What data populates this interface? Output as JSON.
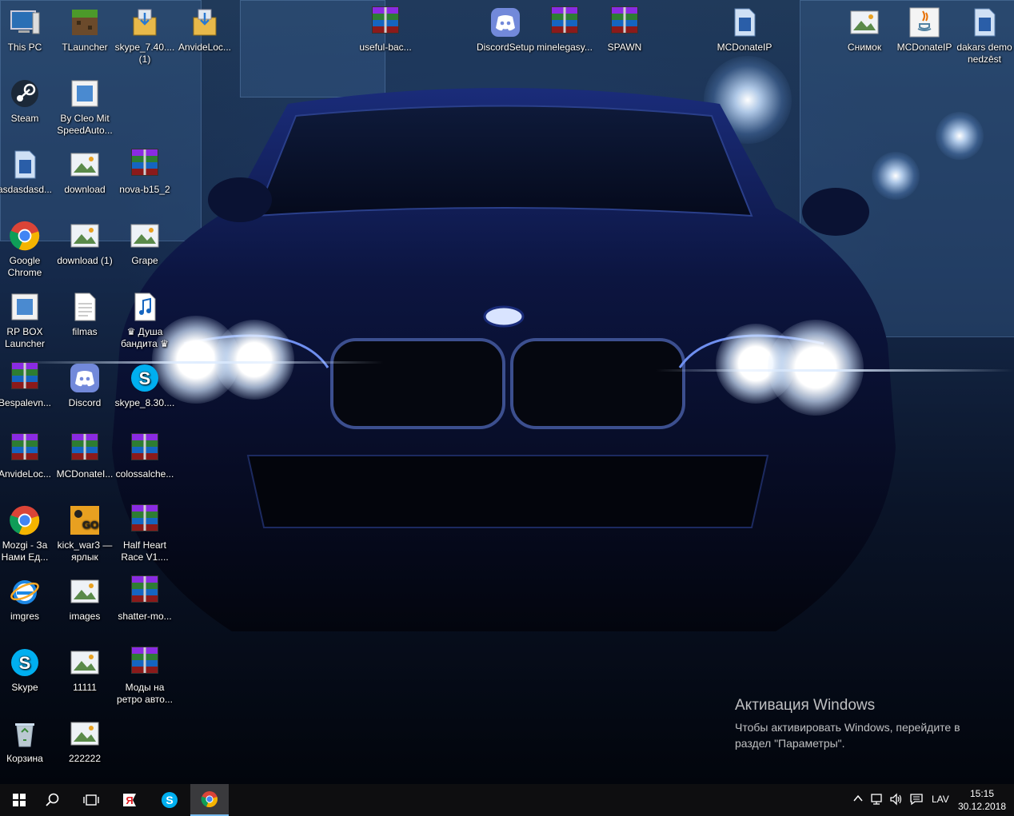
{
  "desktop": {
    "icons": [
      {
        "label": "This PC",
        "kind": "pc-icon"
      },
      {
        "label": "TLauncher",
        "kind": "tlauncher-icon"
      },
      {
        "label": "skype_7.40....\n(1)",
        "kind": "installer-icon"
      },
      {
        "label": "AnvideLoc...",
        "kind": "installer-icon"
      },
      {
        "label": "useful-bac...",
        "kind": "winrar-archive-icon"
      },
      {
        "label": "DiscordSetup",
        "kind": "discord-icon"
      },
      {
        "label": "minelegasy...",
        "kind": "winrar-archive-icon"
      },
      {
        "label": "SPAWN",
        "kind": "winrar-archive-icon"
      },
      {
        "label": "MCDonateIP",
        "kind": "file-icon"
      },
      {
        "label": "Снимок",
        "kind": "image-icon"
      },
      {
        "label": "MCDonateIP",
        "kind": "java-icon"
      },
      {
        "label": "dakars demo\nnedzēst",
        "kind": "file-icon"
      },
      {
        "label": "Steam",
        "kind": "steam-icon"
      },
      {
        "label": "By Cleo Mit\nSpeedAuto...",
        "kind": "shortcut-icon"
      },
      {
        "label": "asdasdasd...",
        "kind": "file-icon"
      },
      {
        "label": "download",
        "kind": "image-icon"
      },
      {
        "label": "nova-b15_2",
        "kind": "winrar-archive-icon"
      },
      {
        "label": "Google\nChrome",
        "kind": "chrome-icon"
      },
      {
        "label": "download (1)",
        "kind": "image-icon"
      },
      {
        "label": "Grape",
        "kind": "image-icon"
      },
      {
        "label": "RP BOX\nLauncher",
        "kind": "shortcut-icon"
      },
      {
        "label": "filmas",
        "kind": "text-file-icon"
      },
      {
        "label": "♛ Душа\nбандита ♛",
        "kind": "mp3-icon"
      },
      {
        "label": "Bespalevn...",
        "kind": "winrar-archive-icon"
      },
      {
        "label": "Discord",
        "kind": "discord-icon"
      },
      {
        "label": "skype_8.30....",
        "kind": "skype-installer-icon"
      },
      {
        "label": "AnvideLoc...",
        "kind": "winrar-archive-icon"
      },
      {
        "label": "MCDonateI...",
        "kind": "winrar-archive-icon"
      },
      {
        "label": "colossalche...",
        "kind": "winrar-archive-icon"
      },
      {
        "label": "Mozgi - За\nНами Ед...",
        "kind": "chrome-icon"
      },
      {
        "label": "kick_war3 —\nярлык",
        "kind": "csgo-icon"
      },
      {
        "label": "Half Heart\nRace V1....",
        "kind": "winrar-archive-icon"
      },
      {
        "label": "imgres",
        "kind": "ie-icon"
      },
      {
        "label": "images",
        "kind": "image-icon"
      },
      {
        "label": "shatter-mo...",
        "kind": "winrar-archive-icon"
      },
      {
        "label": "Skype",
        "kind": "skype-icon"
      },
      {
        "label": "11111",
        "kind": "image-icon"
      },
      {
        "label": "Моды на\nретро авто...",
        "kind": "winrar-archive-icon"
      },
      {
        "label": "Корзина",
        "kind": "recycle-bin-icon"
      },
      {
        "label": "222222",
        "kind": "image-icon"
      }
    ],
    "activation": {
      "title": "Активация Windows",
      "message": "Чтобы активировать Windows, перейдите в раздел \"Параметры\"."
    }
  },
  "taskbar": {
    "buttons": [
      {
        "name": "start-button",
        "icon": "windows-logo-icon"
      },
      {
        "name": "search-button",
        "icon": "search-icon"
      },
      {
        "name": "task-view-button",
        "icon": "task-view-icon"
      },
      {
        "name": "yandex-browser-button",
        "icon": "yandex-icon"
      },
      {
        "name": "skype-button",
        "icon": "skype-icon"
      },
      {
        "name": "chrome-button",
        "icon": "chrome-icon",
        "active": true
      }
    ],
    "tray": {
      "language": "LAV",
      "time": "15:15",
      "date": "30.12.2018"
    }
  },
  "colors": {
    "taskbar_bg": "#0e0e10",
    "accent": "#76b9ed"
  }
}
